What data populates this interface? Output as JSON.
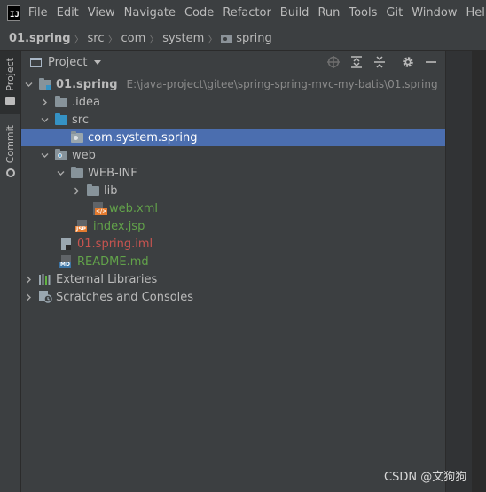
{
  "menubar": {
    "logo": "IJ",
    "items": [
      "File",
      "Edit",
      "View",
      "Navigate",
      "Code",
      "Refactor",
      "Build",
      "Run",
      "Tools",
      "Git",
      "Window",
      "Help"
    ]
  },
  "breadcrumb": {
    "items": [
      "01.spring",
      "src",
      "com",
      "system",
      "spring"
    ]
  },
  "sidebar": {
    "project_tab": "Project",
    "commit_tab": "Commit"
  },
  "panel": {
    "title": "Project",
    "header_icons": [
      "locate-icon",
      "expand-all-icon",
      "collapse-all-icon",
      "gear-icon",
      "minimize-icon"
    ]
  },
  "tree": {
    "rows": [
      {
        "label": "01.spring",
        "path": "E:\\java-project\\gitee\\spring-spring-mvc-my-batis\\01.spring",
        "icon": "module-folder-icon",
        "state": "expanded"
      },
      {
        "label": ".idea",
        "icon": "folder-icon",
        "state": "collapsed"
      },
      {
        "label": "src",
        "icon": "source-folder-icon",
        "state": "expanded"
      },
      {
        "label": "com.system.spring",
        "icon": "package-icon",
        "state": "leaf",
        "selected": true
      },
      {
        "label": "web",
        "icon": "web-folder-icon",
        "state": "expanded"
      },
      {
        "label": "WEB-INF",
        "icon": "folder-icon",
        "state": "expanded"
      },
      {
        "label": "lib",
        "icon": "folder-icon",
        "state": "collapsed"
      },
      {
        "label": "web.xml",
        "icon": "xml-file-icon",
        "state": "leaf",
        "color": "green"
      },
      {
        "label": "index.jsp",
        "icon": "jsp-file-icon",
        "state": "leaf",
        "color": "green"
      },
      {
        "label": "01.spring.iml",
        "icon": "iml-file-icon",
        "state": "leaf",
        "color": "red"
      },
      {
        "label": "README.md",
        "icon": "markdown-file-icon",
        "state": "leaf",
        "color": "green"
      },
      {
        "label": "External Libraries",
        "icon": "libraries-icon",
        "state": "collapsed"
      },
      {
        "label": "Scratches and Consoles",
        "icon": "scratches-icon",
        "state": "collapsed"
      }
    ]
  },
  "colors": {
    "selection": "#4b6eaf",
    "added_file": "#62a24a",
    "unversioned_file": "#c75450"
  },
  "watermark": "CSDN @文狗狗"
}
